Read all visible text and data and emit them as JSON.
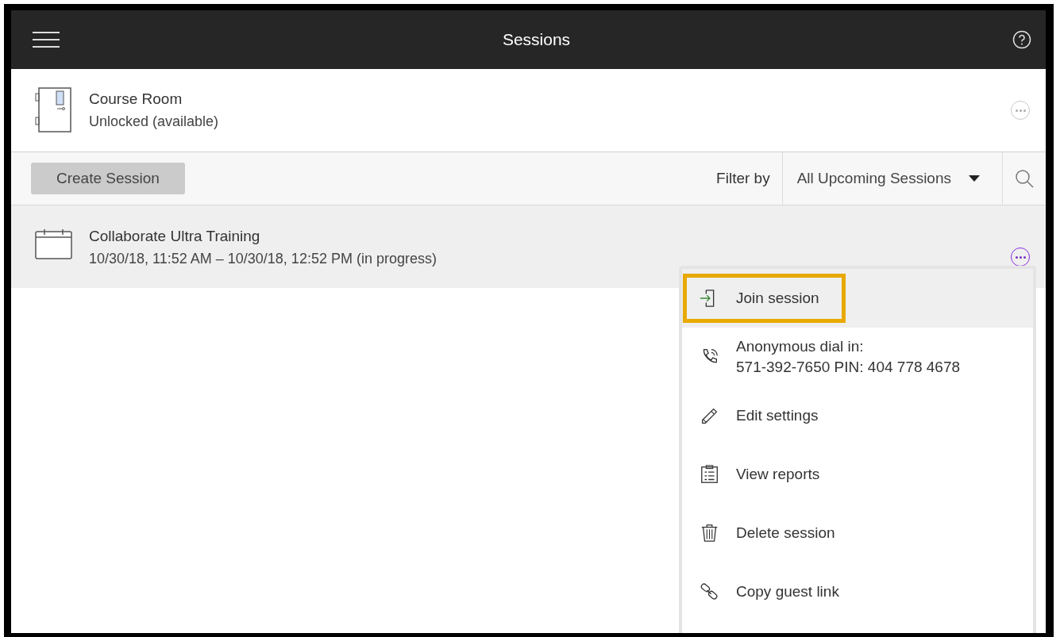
{
  "header": {
    "title": "Sessions"
  },
  "course_room": {
    "title": "Course Room",
    "status": "Unlocked (available)"
  },
  "toolbar": {
    "create_button": "Create Session",
    "filter_label": "Filter by",
    "filter_value": "All Upcoming Sessions"
  },
  "sessions": [
    {
      "title": "Collaborate Ultra Training",
      "time": "10/30/18, 11:52 AM – 10/30/18, 12:52 PM (in progress)",
      "menu_open": true
    }
  ],
  "menu": {
    "items": [
      {
        "kind": "join",
        "label": "Join session",
        "highlighted": true
      },
      {
        "kind": "phone",
        "label": "Anonymous dial in:",
        "detail": "571-392-7650 PIN: 404 778 4678",
        "highlighted": false
      },
      {
        "kind": "edit",
        "label": "Edit settings",
        "highlighted": false
      },
      {
        "kind": "report",
        "label": "View reports",
        "highlighted": false
      },
      {
        "kind": "delete",
        "label": "Delete session",
        "highlighted": false
      },
      {
        "kind": "link",
        "label": "Copy guest link",
        "highlighted": false
      }
    ]
  }
}
